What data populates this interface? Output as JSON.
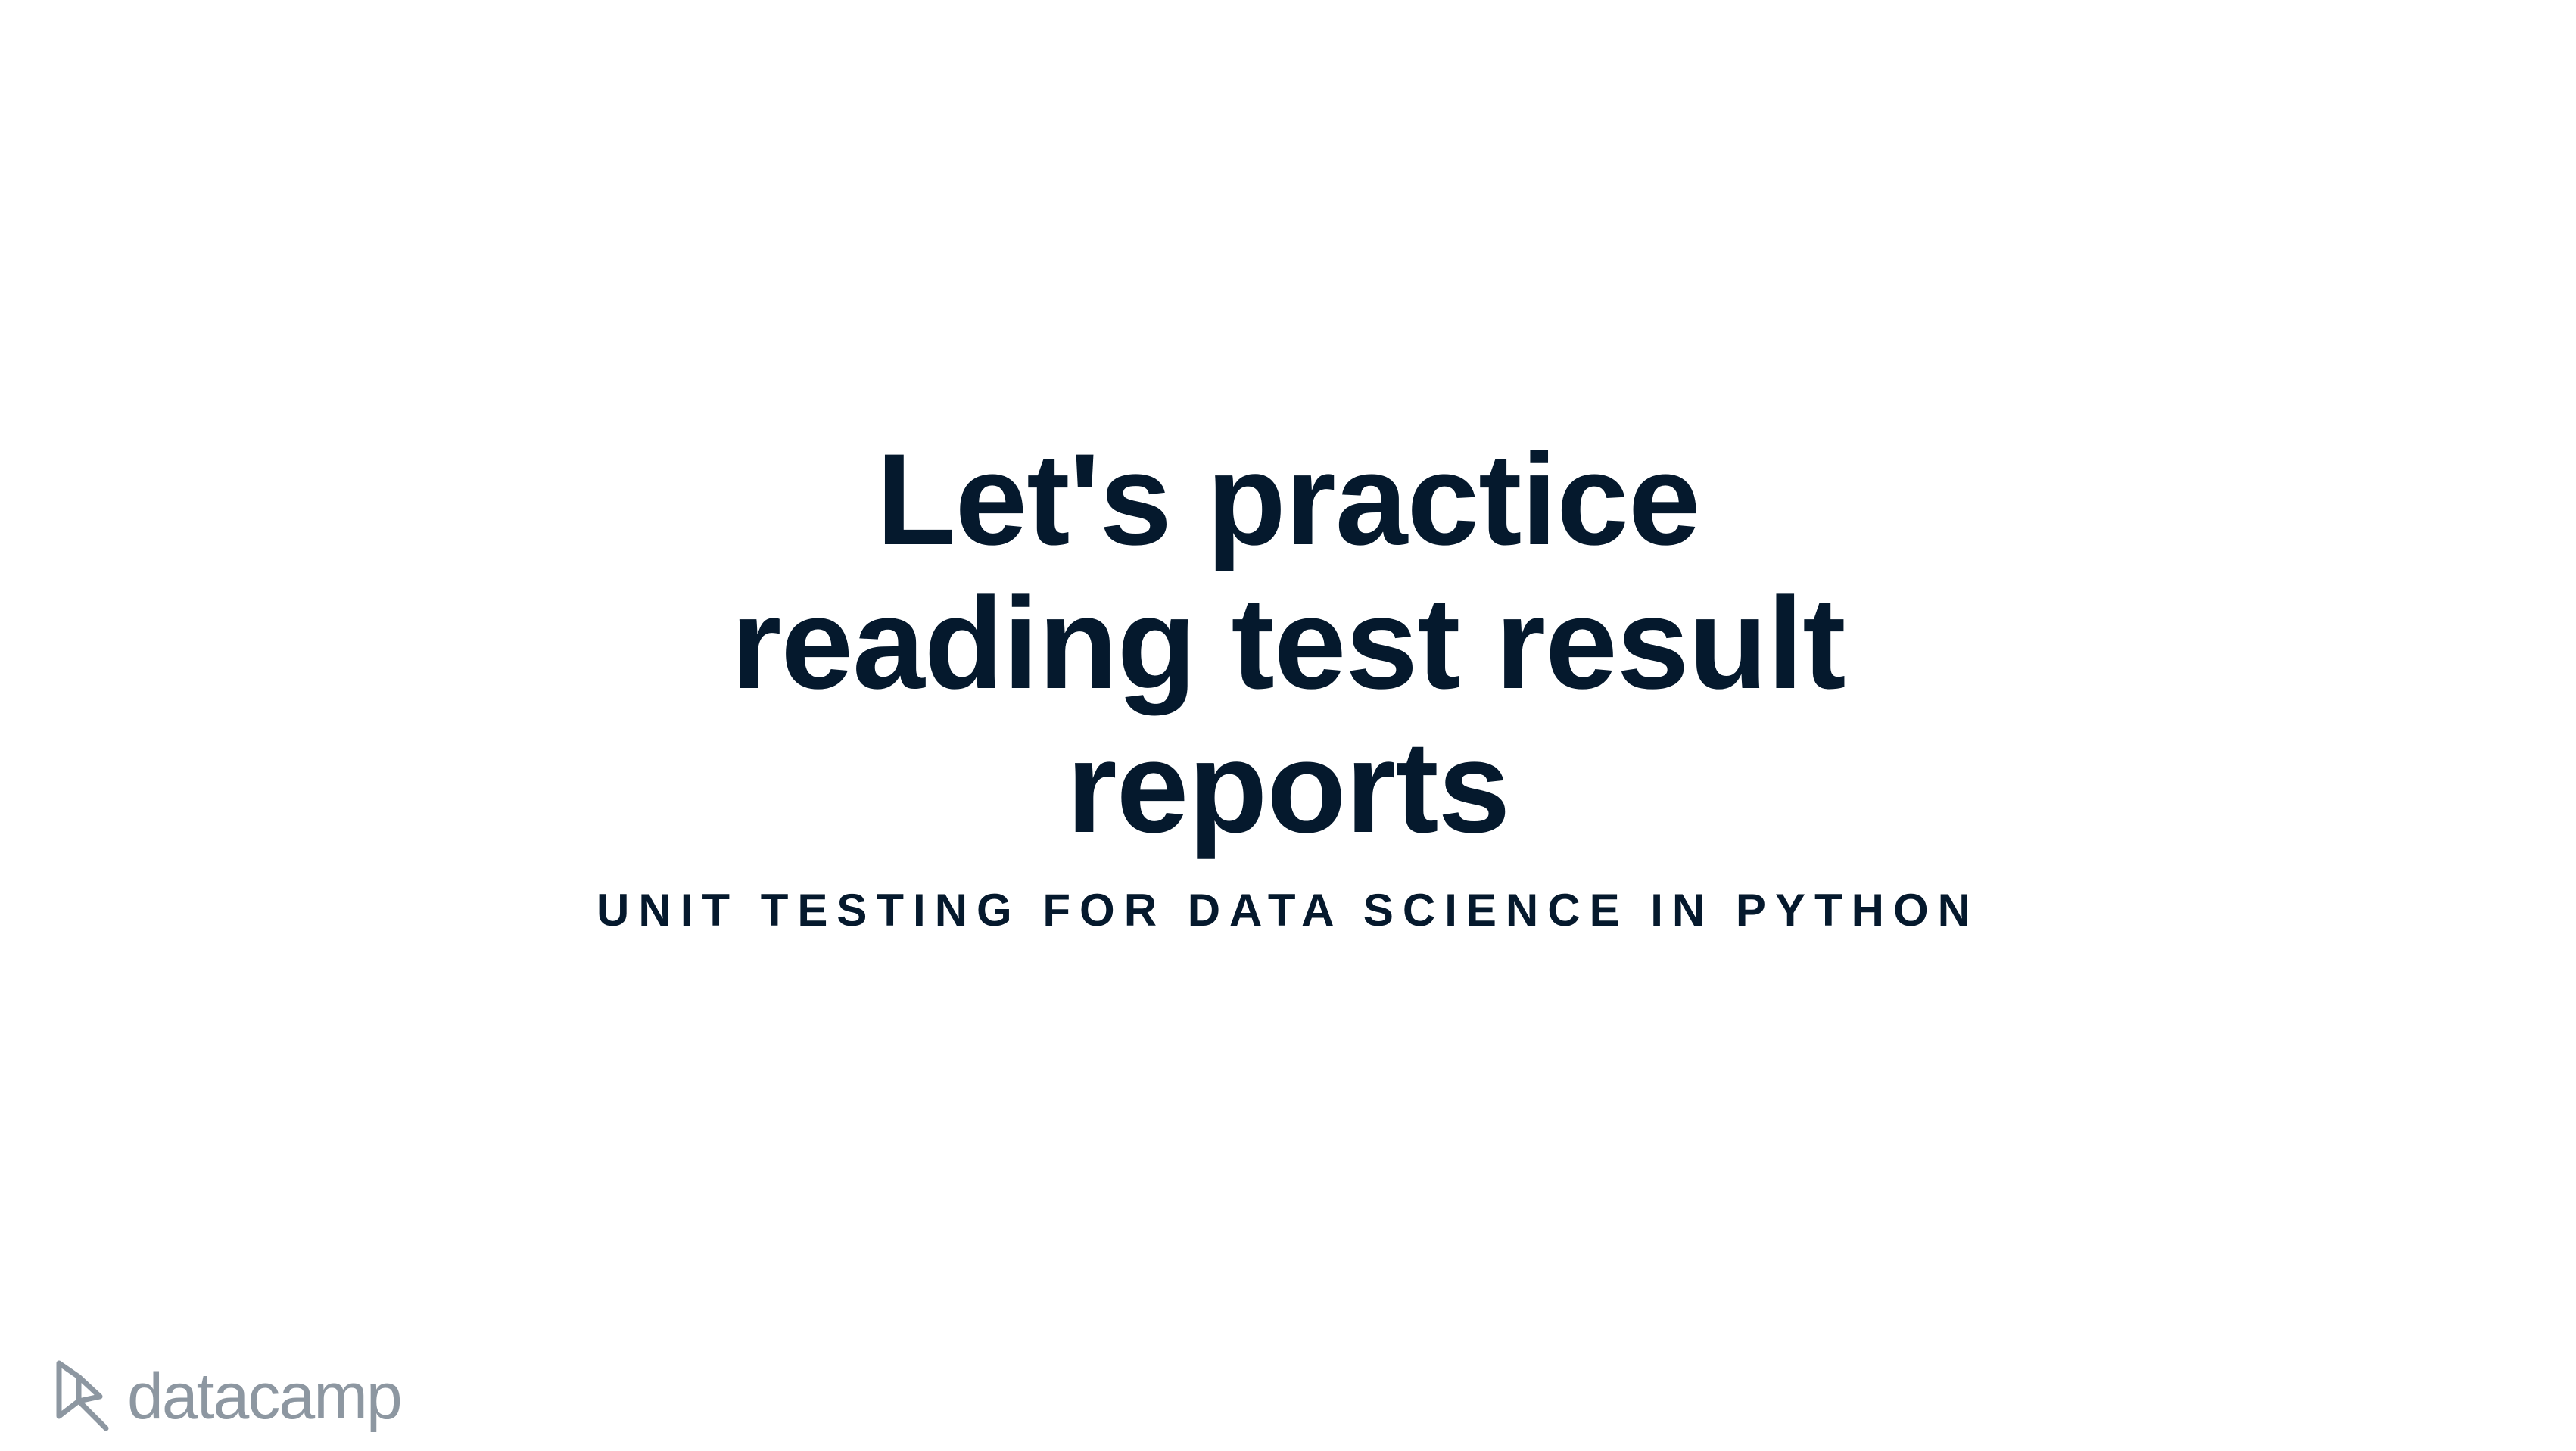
{
  "slide": {
    "title_lines": [
      "Let's practice",
      "reading test result",
      "reports"
    ],
    "subtitle": "UNIT TESTING FOR DATA SCIENCE IN PYTHON",
    "brand": "datacamp",
    "brand_logo_icon": "datacamp-logo-icon"
  },
  "colors": {
    "title": "#05192d",
    "subtitle": "#05192d",
    "logo": "#8d97a1",
    "background": "#ffffff"
  }
}
